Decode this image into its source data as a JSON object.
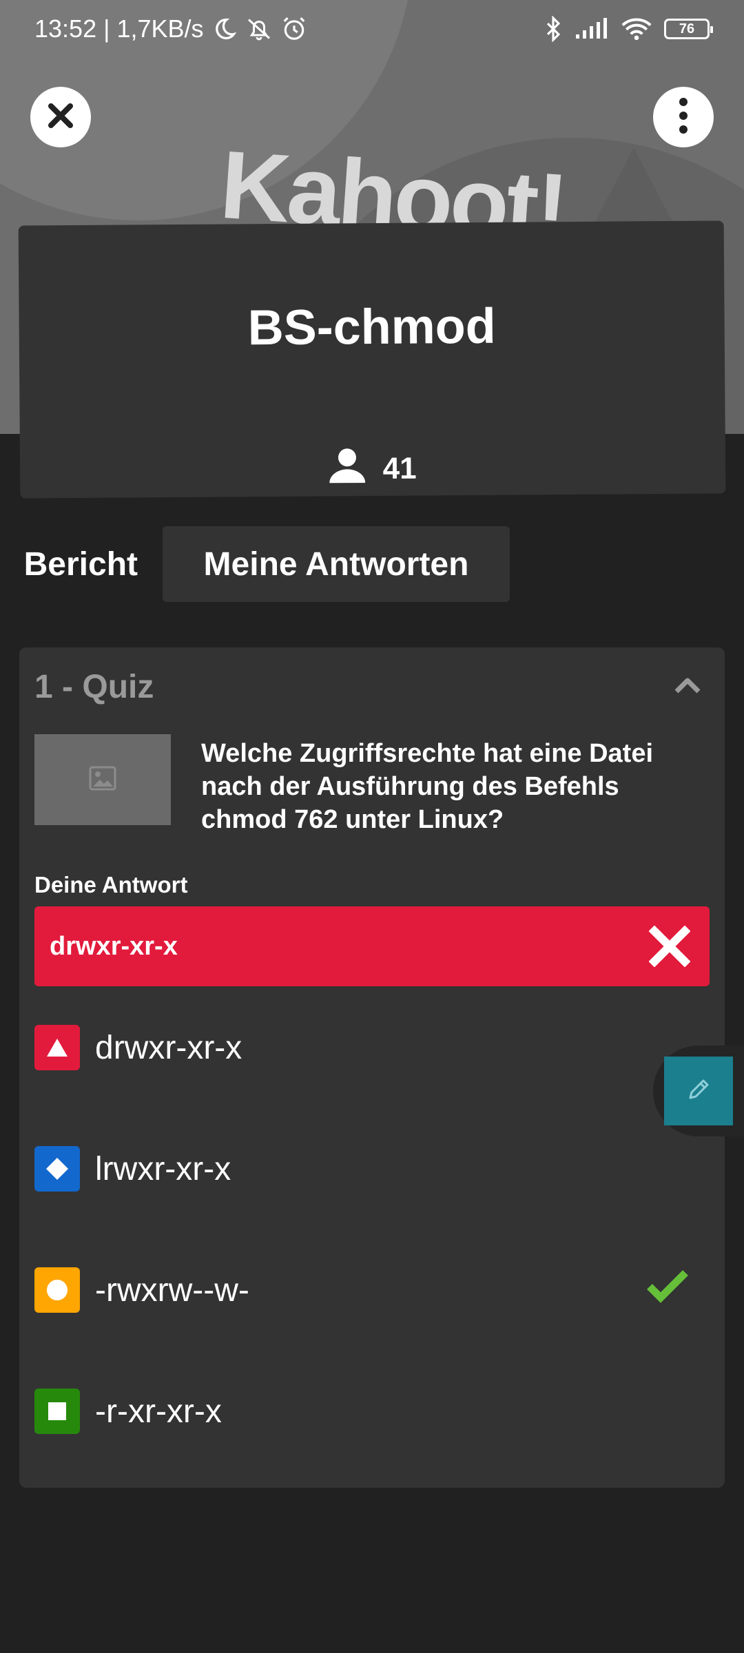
{
  "status_bar": {
    "time_speed": "13:52 | 1,7KB/s",
    "battery": "76"
  },
  "hero": {
    "brand": "Kahoot!"
  },
  "kahoot": {
    "title": "BS-chmod",
    "player_count": "41"
  },
  "tabs": {
    "report": "Bericht",
    "my_answers": "Meine Antworten"
  },
  "question": {
    "header": "1 - Quiz",
    "text": "Welche Zugriffsrechte hat eine Datei nach der Ausführung des Befehls chmod 762 unter Linux?",
    "your_answer_label": "Deine Antwort",
    "your_answer": "drwxr-xr-x",
    "options": [
      {
        "label": "drwxr-xr-x",
        "shape": "triangle-icon",
        "color": "#e21b3c"
      },
      {
        "label": "lrwxr-xr-x",
        "shape": "diamond-icon",
        "color": "#1368ce"
      },
      {
        "label": "-rwxrw--w-",
        "shape": "circle-icon",
        "color": "#ffa602",
        "correct": true
      },
      {
        "label": "-r-xr-xr-x",
        "shape": "square-icon",
        "color": "#26890c"
      }
    ]
  },
  "colors": {
    "wrong": "#e21b3c",
    "correct_check": "#66bf39",
    "edit_button": "#1b7f8e"
  }
}
